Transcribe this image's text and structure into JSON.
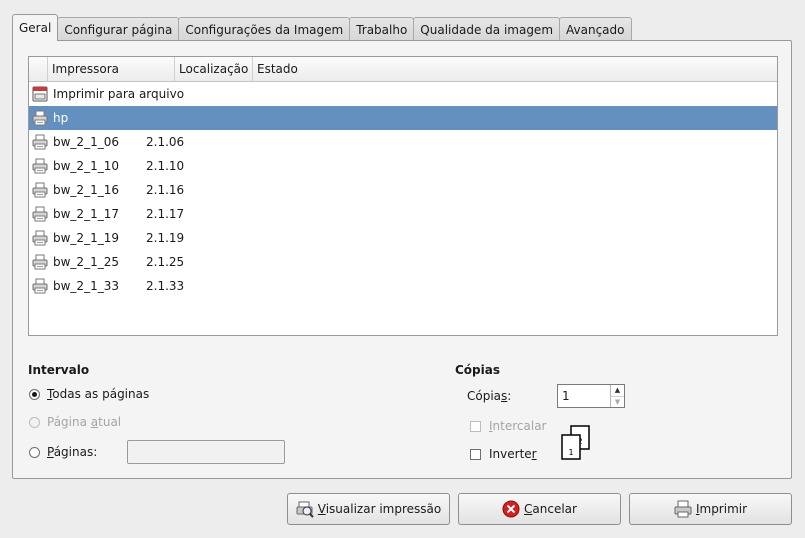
{
  "tabs": [
    "Geral",
    "Configurar página",
    "Configurações da Imagem",
    "Trabalho",
    "Qualidade da imagem",
    "Avançado"
  ],
  "printer_list": {
    "headers": [
      "Impressora",
      "Localização",
      "Estado"
    ],
    "rows": [
      {
        "name": "Imprimir para arquivo",
        "location": "",
        "state": "",
        "icon": "file-print-icon",
        "selected": false
      },
      {
        "name": "hp",
        "location": "",
        "state": "",
        "icon": "printer-icon",
        "selected": true
      },
      {
        "name": "bw_2_1_06",
        "location": "2.1.06",
        "state": "",
        "icon": "printer-icon",
        "selected": false
      },
      {
        "name": "bw_2_1_10",
        "location": "2.1.10",
        "state": "",
        "icon": "printer-icon",
        "selected": false
      },
      {
        "name": "bw_2_1_16",
        "location": "2.1.16",
        "state": "",
        "icon": "printer-icon",
        "selected": false
      },
      {
        "name": "bw_2_1_17",
        "location": "2.1.17",
        "state": "",
        "icon": "printer-icon",
        "selected": false
      },
      {
        "name": "bw_2_1_19",
        "location": "2.1.19",
        "state": "",
        "icon": "printer-icon",
        "selected": false
      },
      {
        "name": "bw_2_1_25",
        "location": "2.1.25",
        "state": "",
        "icon": "printer-icon",
        "selected": false
      },
      {
        "name": "bw_2_1_33",
        "location": "2.1.33",
        "state": "",
        "icon": "printer-icon",
        "selected": false
      }
    ]
  },
  "range": {
    "title": "Intervalo",
    "all_pages": {
      "first": "T",
      "rest": "odas as páginas"
    },
    "current_page": {
      "before": "Página ",
      "mn": "a",
      "after": "tual"
    },
    "pages": {
      "first": "P",
      "rest": "áginas:"
    },
    "pages_value": ""
  },
  "copies": {
    "title": "Cópias",
    "label_before": "Cópia",
    "label_mn": "s",
    "label_after": ":",
    "value": "1",
    "collate": {
      "mn": "I",
      "rest": "ntercalar"
    },
    "reverse": {
      "before": "Inverte",
      "mn": "r"
    },
    "collate_page_labels": [
      "1",
      "2"
    ]
  },
  "buttons": {
    "preview": {
      "mn": "V",
      "rest": "isualizar impressão"
    },
    "cancel": {
      "mn": "C",
      "rest": "ancelar"
    },
    "print": {
      "mn": "I",
      "rest": "mprimir"
    }
  },
  "colors": {
    "selection": "#6490c0",
    "cancel_red": "#d42020"
  }
}
